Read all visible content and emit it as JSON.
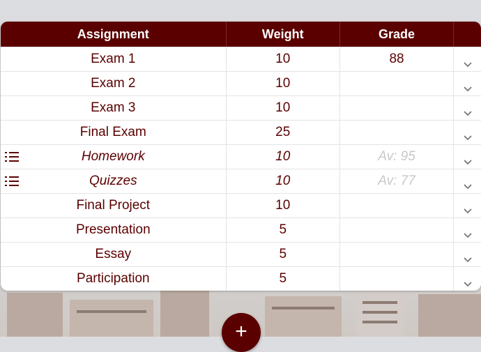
{
  "table": {
    "headers": {
      "assignment": "Assignment",
      "weight": "Weight",
      "grade": "Grade"
    },
    "rows": [
      {
        "assignment": "Exam 1",
        "weight": "10",
        "grade": "88",
        "group": false
      },
      {
        "assignment": "Exam 2",
        "weight": "10",
        "grade": "",
        "group": false
      },
      {
        "assignment": "Exam 3",
        "weight": "10",
        "grade": "",
        "group": false
      },
      {
        "assignment": "Final Exam",
        "weight": "25",
        "grade": "",
        "group": false
      },
      {
        "assignment": "Homework",
        "weight": "10",
        "grade": "Av: 95",
        "group": true
      },
      {
        "assignment": "Quizzes",
        "weight": "10",
        "grade": "Av: 77",
        "group": true
      },
      {
        "assignment": "Final Project",
        "weight": "10",
        "grade": "",
        "group": false
      },
      {
        "assignment": "Presentation",
        "weight": "5",
        "grade": "",
        "group": false
      },
      {
        "assignment": "Essay",
        "weight": "5",
        "grade": "",
        "group": false
      },
      {
        "assignment": "Participation",
        "weight": "5",
        "grade": "",
        "group": false
      }
    ]
  },
  "fab": {
    "label": "+"
  },
  "colors": {
    "accent": "#5b0000",
    "muted": "#c8c8c8",
    "border": "#e4e4e4"
  },
  "icons": {
    "group_row": "list-icon",
    "row_expand": "chevron-down-icon",
    "add": "plus-icon"
  }
}
